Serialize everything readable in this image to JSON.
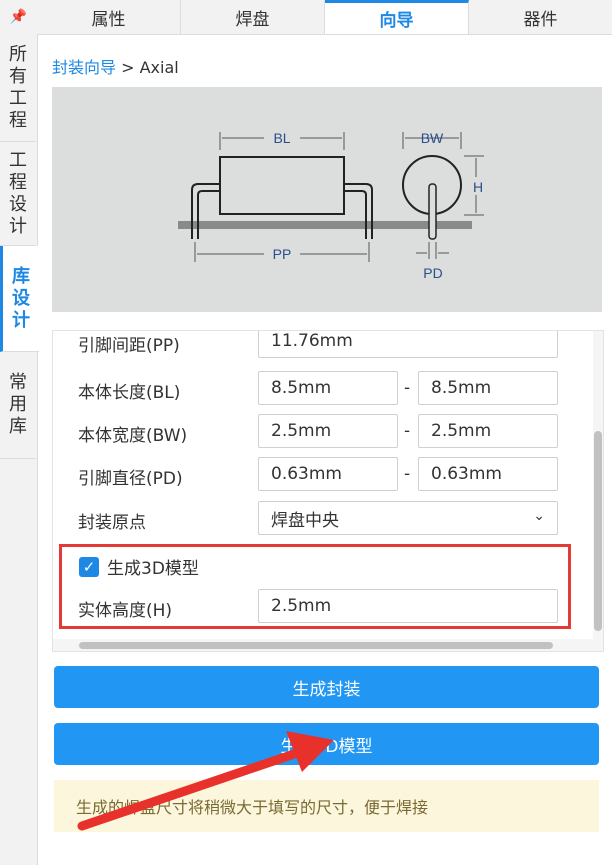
{
  "top_tabs": [
    "属性",
    "焊盘",
    "向导",
    "器件"
  ],
  "active_top_tab": "向导",
  "left_tabs": [
    {
      "label": "所有工程",
      "chars": [
        "所",
        "有",
        "工",
        "程"
      ]
    },
    {
      "label": "工程设计",
      "chars": [
        "工",
        "程",
        "设",
        "计"
      ]
    },
    {
      "label": "库设计",
      "chars": [
        "库",
        "设",
        "计"
      ]
    },
    {
      "label": "常用库",
      "chars": [
        "常",
        "用",
        "库"
      ]
    }
  ],
  "breadcrumb": {
    "link": "封装向导",
    "separator": " > ",
    "current": "Axial"
  },
  "diagram": {
    "labels": {
      "bl": "BL",
      "pp": "PP",
      "bw": "BW",
      "h": "H",
      "pd": "PD"
    }
  },
  "form": {
    "pp_label": "引脚间距(PP)",
    "pp_value": "11.76mm",
    "bl_label": "本体长度(BL)",
    "bl_min": "8.5mm",
    "bl_max": "8.5mm",
    "bw_label": "本体宽度(BW)",
    "bw_min": "2.5mm",
    "bw_max": "2.5mm",
    "pd_label": "引脚直径(PD)",
    "pd_min": "0.63mm",
    "pd_max": "0.63mm",
    "dash": "-",
    "origin_label": "封装原点",
    "origin_value": "焊盘中央",
    "gen3d_label": "生成3D模型",
    "gen3d_checked": true,
    "height_label": "实体高度(H)",
    "height_value": "2.5mm"
  },
  "buttons": {
    "generate_footprint": "生成封装",
    "generate_3d": "生成3D模型"
  },
  "note": "生成的焊盘尺寸将稍微大于填写的尺寸，便于焊接",
  "colors": {
    "accent": "#1e88e5",
    "button": "#2196f3",
    "highlight": "#e53935",
    "note_bg": "#fcf6dc",
    "diagram_bg": "#dcdedd"
  }
}
